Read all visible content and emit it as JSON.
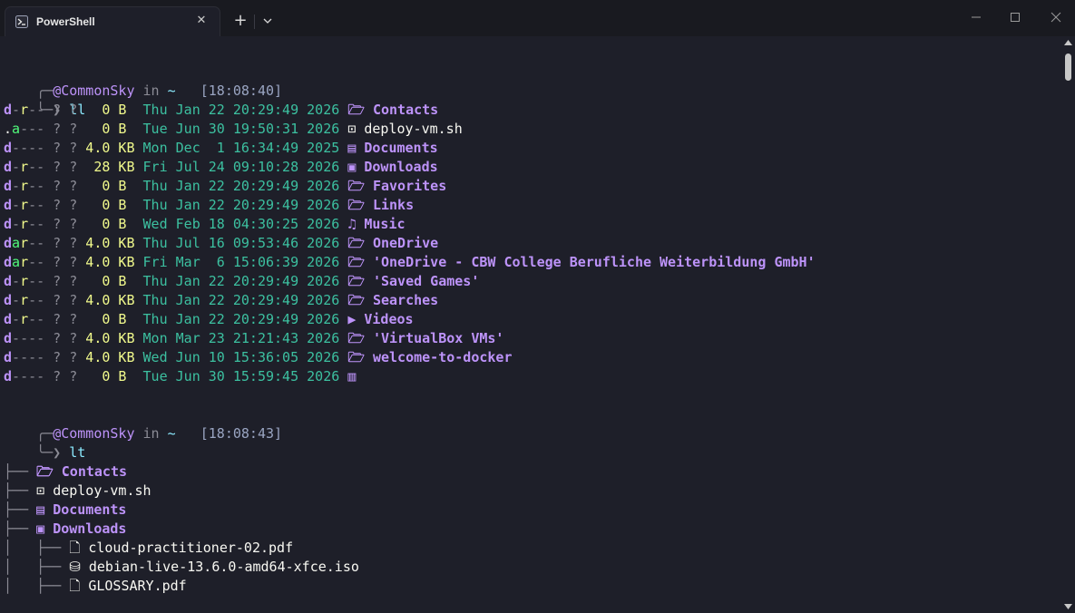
{
  "window": {
    "tab_title": "PowerShell",
    "tab_icon": "powershell-icon",
    "close_tab_glyph": "✕",
    "new_tab_glyph": "+"
  },
  "colors": {
    "background": "#1e1f29",
    "titlebar": "#191a20",
    "directory": "#bd93f9",
    "size": "#f1fa8c",
    "date": "#3cc0a0",
    "attribute": "#50fa7b"
  },
  "prompt1": {
    "user": "@CommonSky",
    "in": " in ",
    "path": "~",
    "time": "[18:08:40]",
    "command": "ll"
  },
  "listing": [
    {
      "a1": "d",
      "a2": "-",
      "a3": "r",
      "a4": "--",
      "q": " ? ?",
      "size": "   0 B ",
      "date": " Thu Jan 22 20:29:49 2026",
      "icon": "🗁",
      "name": "Contacts",
      "dir": true
    },
    {
      "a1": ".",
      "a2": "a",
      "a3": "-",
      "a4": "--",
      "q": " ? ?",
      "size": "   0 B ",
      "date": " Tue Jun 30 19:50:31 2026",
      "icon": "⊡",
      "name": "deploy-vm.sh",
      "dir": false
    },
    {
      "a1": "d",
      "a2": "-",
      "a3": "-",
      "a4": "--",
      "q": " ? ?",
      "size": " 4.0 KB",
      "date": " Mon Dec  1 16:34:49 2025",
      "icon": "▤",
      "name": "Documents",
      "dir": true
    },
    {
      "a1": "d",
      "a2": "-",
      "a3": "r",
      "a4": "--",
      "q": " ? ?",
      "size": "  28 KB",
      "date": " Fri Jul 24 09:10:28 2026",
      "icon": "▣",
      "name": "Downloads",
      "dir": true
    },
    {
      "a1": "d",
      "a2": "-",
      "a3": "r",
      "a4": "--",
      "q": " ? ?",
      "size": "   0 B ",
      "date": " Thu Jan 22 20:29:49 2026",
      "icon": "🗁",
      "name": "Favorites",
      "dir": true
    },
    {
      "a1": "d",
      "a2": "-",
      "a3": "r",
      "a4": "--",
      "q": " ? ?",
      "size": "   0 B ",
      "date": " Thu Jan 22 20:29:49 2026",
      "icon": "🗁",
      "name": "Links",
      "dir": true
    },
    {
      "a1": "d",
      "a2": "-",
      "a3": "r",
      "a4": "--",
      "q": " ? ?",
      "size": "   0 B ",
      "date": " Wed Feb 18 04:30:25 2026",
      "icon": "♫",
      "name": "Music",
      "dir": true
    },
    {
      "a1": "d",
      "a2": "a",
      "a3": "r",
      "a4": "--",
      "q": " ? ?",
      "size": " 4.0 KB",
      "date": " Thu Jul 16 09:53:46 2026",
      "icon": "🗁",
      "name": "OneDrive",
      "dir": true
    },
    {
      "a1": "d",
      "a2": "a",
      "a3": "r",
      "a4": "--",
      "q": " ? ?",
      "size": " 4.0 KB",
      "date": " Fri Mar  6 15:06:39 2026",
      "icon": "🗁",
      "name": "'OneDrive - CBW College Berufliche Weiterbildung GmbH'",
      "dir": true
    },
    {
      "a1": "d",
      "a2": "-",
      "a3": "r",
      "a4": "--",
      "q": " ? ?",
      "size": "   0 B ",
      "date": " Thu Jan 22 20:29:49 2026",
      "icon": "🗁",
      "name": "'Saved Games'",
      "dir": true
    },
    {
      "a1": "d",
      "a2": "-",
      "a3": "r",
      "a4": "--",
      "q": " ? ?",
      "size": " 4.0 KB",
      "date": " Thu Jan 22 20:29:49 2026",
      "icon": "🗁",
      "name": "Searches",
      "dir": true
    },
    {
      "a1": "d",
      "a2": "-",
      "a3": "r",
      "a4": "--",
      "q": " ? ?",
      "size": "   0 B ",
      "date": " Thu Jan 22 20:29:49 2026",
      "icon": "▶",
      "name": "Videos",
      "dir": true
    },
    {
      "a1": "d",
      "a2": "-",
      "a3": "-",
      "a4": "--",
      "q": " ? ?",
      "size": " 4.0 KB",
      "date": " Mon Mar 23 21:21:43 2026",
      "icon": "🗁",
      "name": "'VirtualBox VMs'",
      "dir": true
    },
    {
      "a1": "d",
      "a2": "-",
      "a3": "-",
      "a4": "--",
      "q": " ? ?",
      "size": " 4.0 KB",
      "date": " Wed Jun 10 15:36:05 2026",
      "icon": "🗁",
      "name": "welcome-to-docker",
      "dir": true
    },
    {
      "a1": "d",
      "a2": "-",
      "a3": "-",
      "a4": "--",
      "q": " ? ?",
      "size": "   0 B ",
      "date": " Tue Jun 30 15:59:45 2026",
      "icon": "▥",
      "name": "",
      "dir": true
    }
  ],
  "prompt2": {
    "user": "@CommonSky",
    "in": " in ",
    "path": "~",
    "time": "[18:08:43]",
    "command": "lt"
  },
  "tree_root": {
    "icon": "🗁",
    "name": "."
  },
  "tree": [
    {
      "prefix": "├── ",
      "icon": "🗁",
      "name": "Contacts",
      "dir": true
    },
    {
      "prefix": "├── ",
      "icon": "⊡",
      "name": "deploy-vm.sh",
      "dir": false
    },
    {
      "prefix": "├── ",
      "icon": "▤",
      "name": "Documents",
      "dir": true
    },
    {
      "prefix": "├── ",
      "icon": "▣",
      "name": "Downloads",
      "dir": true
    },
    {
      "prefix": "│   ├── ",
      "icon": "🗋",
      "name": "cloud-practitioner-02.pdf",
      "dir": false
    },
    {
      "prefix": "│   ├── ",
      "icon": "⛁",
      "name": "debian-live-13.6.0-amd64-xfce.iso",
      "dir": false
    },
    {
      "prefix": "│   ├── ",
      "icon": "🗋",
      "name": "GLOSSARY.pdf",
      "dir": false
    }
  ]
}
